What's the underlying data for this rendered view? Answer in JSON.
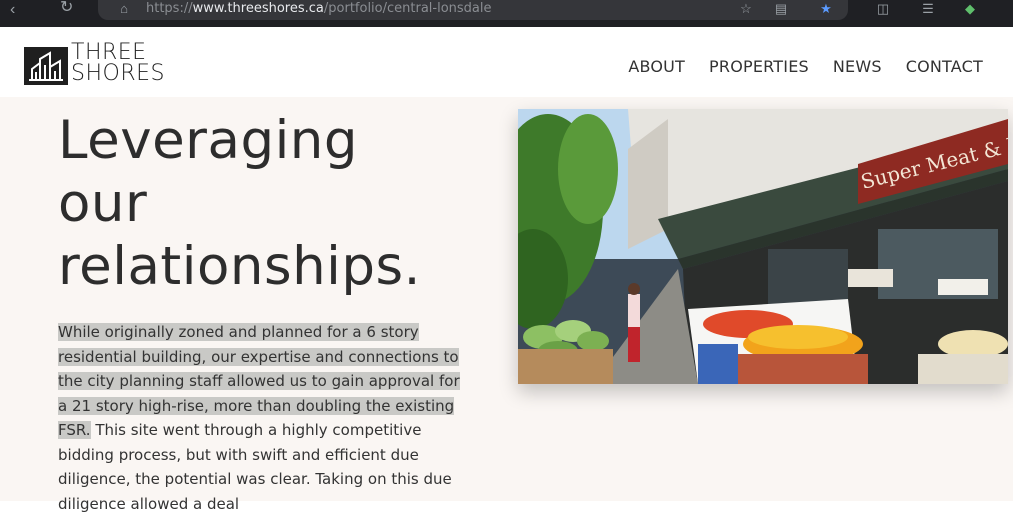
{
  "browser": {
    "url_prefix": "https://",
    "url_domain": "www.threeshores.ca",
    "url_path": "/portfolio/central-lonsdale"
  },
  "header": {
    "logo_line1": "THREE",
    "logo_line2": "SHORES",
    "nav": [
      "ABOUT",
      "PROPERTIES",
      "NEWS",
      "CONTACT"
    ]
  },
  "main": {
    "headline_line1": "Leveraging",
    "headline_line2": "our",
    "headline_line3": "relationships.",
    "paragraph_highlighted": "While originally zoned and planned for a 6 story residential building, our expertise and connections to the city planning staff allowed us to gain approval for a 21 story high-rise, more than doubling the existing FSR.",
    "paragraph_rest": " This site went through a highly competitive bidding process, but with swift and efficient due diligence, the potential was clear. Taking on this due diligence allowed a deal",
    "photo_sign": "Super Meat & Deli"
  },
  "colors": {
    "background": "#faf6f3",
    "highlight": "#c9c9c6",
    "text": "#2d2d2d"
  }
}
